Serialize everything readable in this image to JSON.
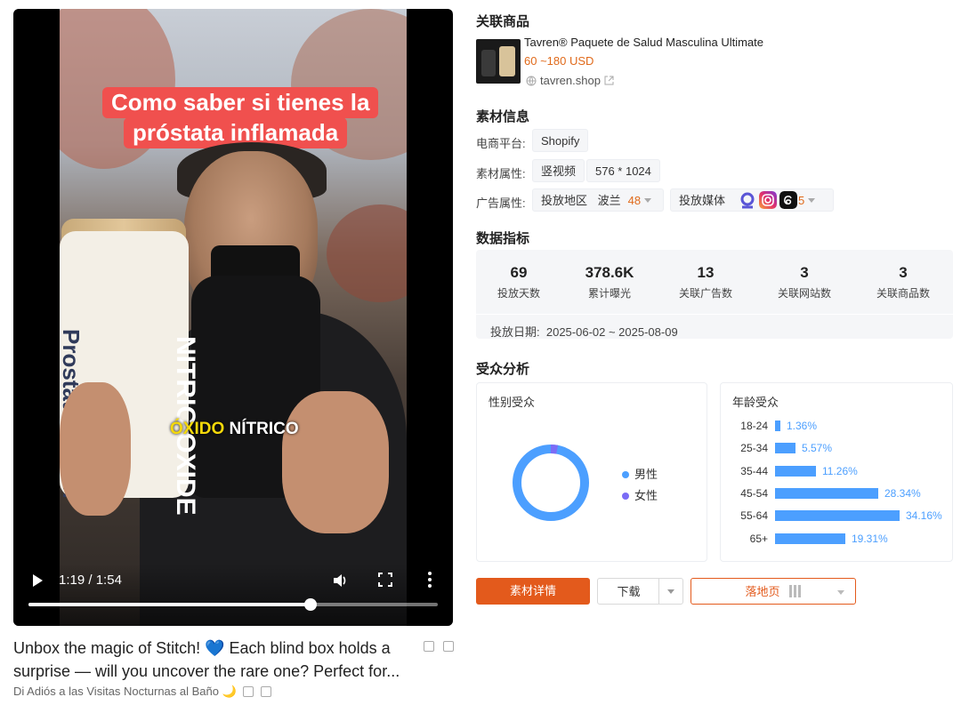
{
  "video": {
    "caption_line1": "Como saber si tienes la",
    "caption_line2": "próstata inflamada",
    "jar_label": "Prostate Health",
    "bottle_label": "NITRIC OXIDE",
    "overlay_yellow": "ÓXIDO",
    "overlay_white": " NÍTRICO",
    "current_time": "1:19",
    "duration": "1:54",
    "time_separator": " / ",
    "progress_fraction": 0.69
  },
  "ad": {
    "title": "Unbox the magic of Stitch! 💙 Each blind box holds a surprise — will you uncover the rare one? Perfect for...",
    "subtitle": "Di Adiós a las Visitas Nocturnas al Baño 🌙"
  },
  "product": {
    "section_title": "关联商品",
    "name": "Tavren® Paquete de Salud Masculina Ultimate",
    "price": "60 ~180 USD",
    "domain": "tavren.shop"
  },
  "material": {
    "section_title": "素材信息",
    "platform_label": "电商平台:",
    "platform_value": "Shopify",
    "attr_label": "素材属性:",
    "attr_type": "竖视频",
    "attr_size": "576 * 1024",
    "ad_label": "广告属性:",
    "region_label": "投放地区",
    "region_value": "波兰",
    "region_count": "48",
    "media_label": "投放媒体",
    "media_count": "5",
    "media_icons": [
      "meta-audience-icon",
      "instagram-icon",
      "threads-icon"
    ]
  },
  "metrics": {
    "section_title": "数据指标",
    "items": [
      {
        "value": "69",
        "label": "投放天数"
      },
      {
        "value": "378.6K",
        "label": "累计曝光"
      },
      {
        "value": "13",
        "label": "关联广告数"
      },
      {
        "value": "3",
        "label": "关联网站数"
      },
      {
        "value": "3",
        "label": "关联商品数"
      }
    ],
    "date_label": "投放日期:",
    "date_range": "2025-06-02 ~ 2025-08-09"
  },
  "audience": {
    "section_title": "受众分析",
    "gender_title": "性别受众",
    "gender_legend": [
      {
        "label": "男性",
        "color": "#4c9fff"
      },
      {
        "label": "女性",
        "color": "#7b6cf6"
      }
    ],
    "gender_share_female": 0.03,
    "age_title": "年龄受众",
    "age": [
      {
        "label": "18-24",
        "pct": "1.36%",
        "value": 1.36
      },
      {
        "label": "25-34",
        "pct": "5.57%",
        "value": 5.57
      },
      {
        "label": "35-44",
        "pct": "11.26%",
        "value": 11.26
      },
      {
        "label": "45-54",
        "pct": "28.34%",
        "value": 28.34
      },
      {
        "label": "55-64",
        "pct": "34.16%",
        "value": 34.16
      },
      {
        "label": "65+",
        "pct": "19.31%",
        "value": 19.31
      }
    ]
  },
  "actions": {
    "detail": "素材详情",
    "download": "下载",
    "landing": "落地页"
  },
  "colors": {
    "accent": "#e35a1c",
    "price": "#e06a1b",
    "bar": "#4c9fff"
  }
}
